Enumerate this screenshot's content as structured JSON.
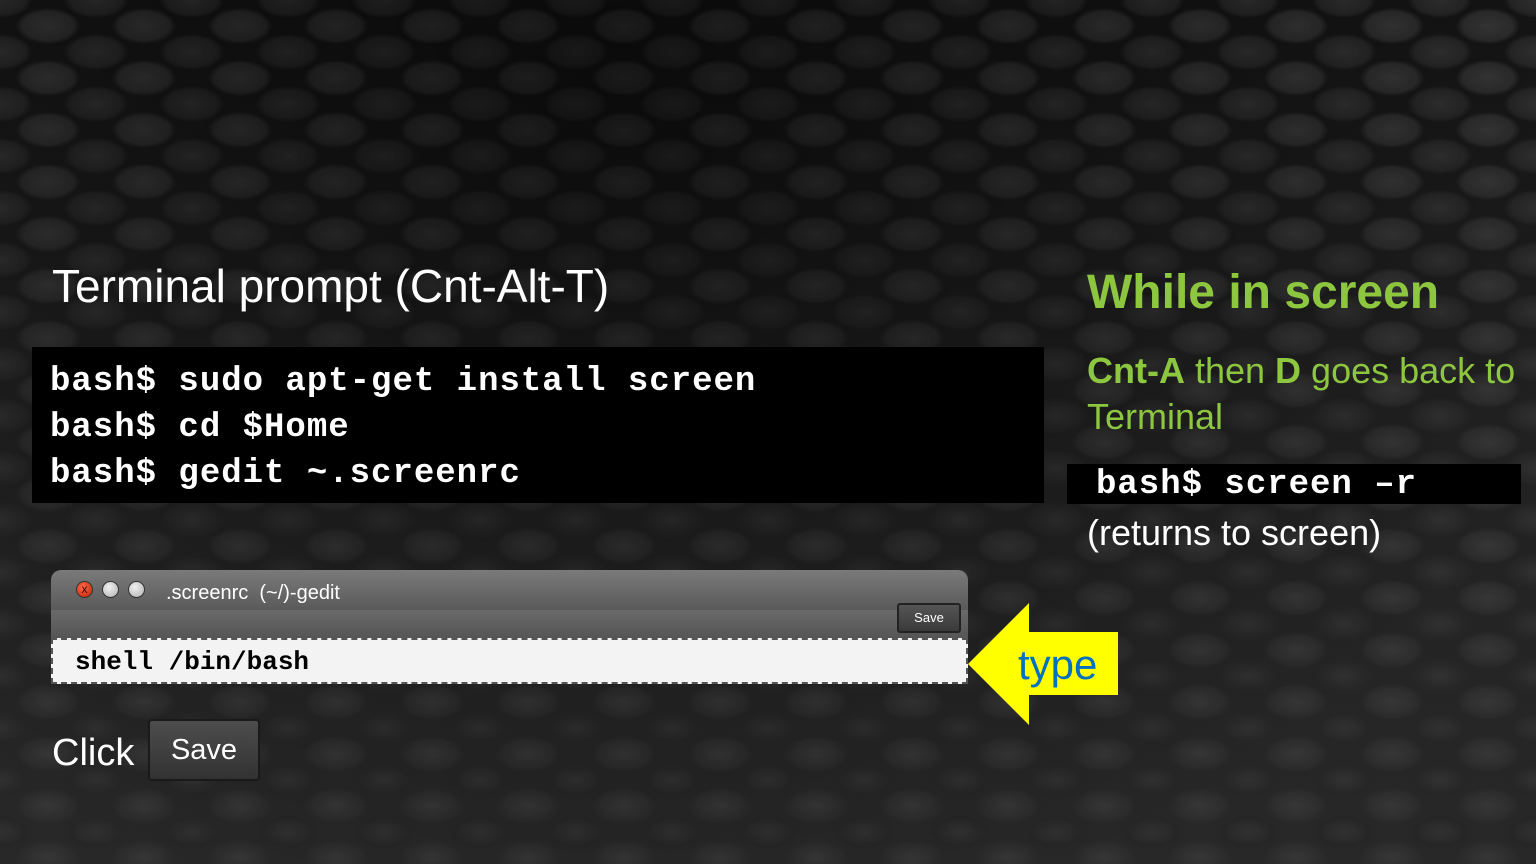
{
  "left": {
    "heading": "Terminal prompt (Cnt-Alt-T)",
    "commands": [
      "bash$ sudo apt-get install screen",
      "bash$ cd $Home",
      "bash$ gedit ~.screenrc"
    ]
  },
  "gedit": {
    "title": ".screenrc  (~/)-gedit",
    "save_label": "Save",
    "text_line": "shell /bin/bash",
    "close_icon": "x"
  },
  "callout": {
    "type_label": "type",
    "arrow_color": "#ffff00",
    "text_color": "#0070c0"
  },
  "click": {
    "label": "Click",
    "save_label": "Save"
  },
  "right": {
    "heading": "While in screen",
    "instr_1": "Cnt-A",
    "instr_2": " then ",
    "instr_3": "D",
    "instr_4": " goes back to Terminal",
    "command": "bash$ screen –r",
    "note": "(returns to screen)",
    "accent": "#8dc63f"
  }
}
